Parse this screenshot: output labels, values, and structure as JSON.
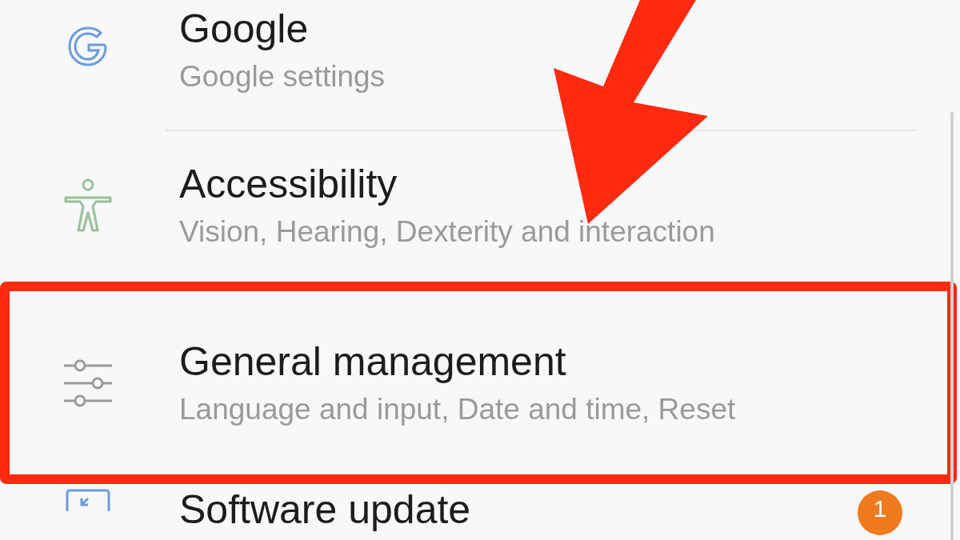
{
  "settings_items": [
    {
      "title": "Google",
      "subtitle": "Google settings",
      "highlighted": false
    },
    {
      "title": "Accessibility",
      "subtitle": "Vision, Hearing, Dexterity and interaction",
      "highlighted": false
    },
    {
      "title": "General management",
      "subtitle": "Language and input, Date and time, Reset",
      "highlighted": true
    },
    {
      "title": "Software update",
      "badge": "1",
      "highlighted": false
    }
  ]
}
